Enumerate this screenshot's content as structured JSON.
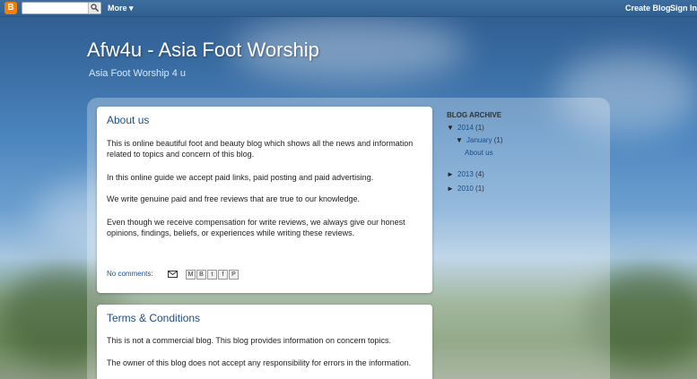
{
  "navbar": {
    "logo": "B",
    "search_placeholder": "",
    "more_label": "More ▾",
    "create_blog": "Create Blog",
    "sign_in": "Sign In"
  },
  "header": {
    "title": "Afw4u - Asia Foot Worship",
    "description": "Asia Foot Worship 4 u"
  },
  "posts": [
    {
      "title": "About us",
      "paragraphs": [
        "This is online beautiful foot and beauty blog which shows all the news and information related to topics and concern of this blog.",
        "In this online guide we accept paid links, paid posting and paid advertising.",
        "We write genuine paid and free reviews that are true to our knowledge.",
        "Even though we receive compensation for write reviews, we always give our honest opinions, findings, beliefs, or experiences while writing these reviews."
      ],
      "comments": "No comments:",
      "share_icons": [
        "email-icon",
        "blogthis-icon",
        "twitter-icon",
        "facebook-icon",
        "pinterest-icon"
      ]
    },
    {
      "title": "Terms & Conditions",
      "paragraphs": [
        "This is not a commercial blog. This blog provides information on concern topics.",
        "The owner of this blog does not accept any responsibility for errors in the information."
      ]
    }
  ],
  "sidebar": {
    "title": "BLOG ARCHIVE",
    "archive": [
      {
        "toggle": "▼",
        "label": "2014",
        "count": "(1)"
      },
      {
        "toggle": "▼",
        "label": "January",
        "count": "(1)"
      },
      {
        "label": "About us"
      },
      {
        "toggle": "►",
        "label": "2013",
        "count": "(4)"
      },
      {
        "toggle": "►",
        "label": "2010",
        "count": "(1)"
      }
    ]
  }
}
